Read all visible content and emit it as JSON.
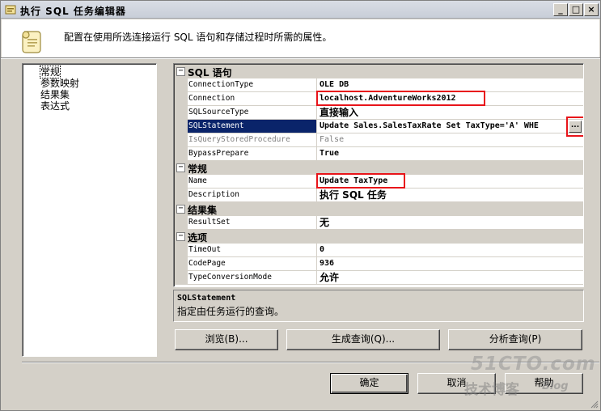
{
  "window": {
    "title": "执行 SQL 任务编辑器",
    "minimize_glyph": "_",
    "maximize_glyph": "□",
    "close_glyph": "×"
  },
  "header": {
    "description": "配置在使用所选连接运行 SQL 语句和存储过程时所需的属性。"
  },
  "nav": {
    "items": [
      "常规",
      "参数映射",
      "结果集",
      "表达式"
    ]
  },
  "grid": {
    "categories": [
      {
        "label": "SQL 语句",
        "toggle": "⊟",
        "properties": [
          {
            "name": "ConnectionType",
            "value": "OLE DB"
          },
          {
            "name": "Connection",
            "value": "localhost.AdventureWorks2012"
          },
          {
            "name": "SQLSourceType",
            "value": "直接输入"
          },
          {
            "name": "SQLStatement",
            "value": "Update Sales.SalesTaxRate Set TaxType='A' WHE"
          },
          {
            "name": "IsQueryStoredProcedure",
            "value": "False"
          },
          {
            "name": "BypassPrepare",
            "value": "True"
          }
        ]
      },
      {
        "label": "常规",
        "toggle": "⊟",
        "properties": [
          {
            "name": "Name",
            "value": "Update TaxType"
          },
          {
            "name": "Description",
            "value": "执行 SQL 任务"
          }
        ]
      },
      {
        "label": "结果集",
        "toggle": "⊟",
        "properties": [
          {
            "name": "ResultSet",
            "value": "无"
          }
        ]
      },
      {
        "label": "选项",
        "toggle": "⊟",
        "properties": [
          {
            "name": "TimeOut",
            "value": "0"
          },
          {
            "name": "CodePage",
            "value": "936"
          },
          {
            "name": "TypeConversionMode",
            "value": "允许"
          }
        ]
      }
    ],
    "ellipsis_label": "..."
  },
  "description_panel": {
    "title": "SQLStatement",
    "text": "指定由任务运行的查询。"
  },
  "action_buttons": {
    "browse": "浏览(B)...",
    "build_query": "生成查询(Q)...",
    "parse_query": "分析查询(P)"
  },
  "dialog_buttons": {
    "ok": "确定",
    "cancel": "取消",
    "help": "帮助"
  },
  "watermark": {
    "site": "51CTO.com",
    "sub": "技术博客",
    "blog": "Blog"
  },
  "colors": {
    "highlight_box": "#e8141a",
    "selection": "#0a246a",
    "chrome": "#d4d0c8"
  }
}
